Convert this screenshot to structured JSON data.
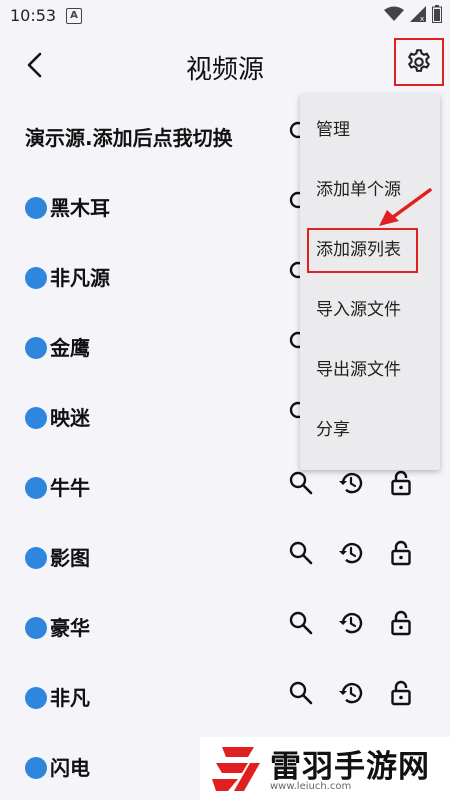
{
  "status": {
    "time": "10:53",
    "notif": "A"
  },
  "header": {
    "title": "视频源"
  },
  "sources": [
    {
      "name": "演示源.添加后点我切换",
      "dot": false
    },
    {
      "name": "黑木耳",
      "dot": true
    },
    {
      "name": "非凡源",
      "dot": true
    },
    {
      "name": "金鹰",
      "dot": true
    },
    {
      "name": "映迷",
      "dot": true
    },
    {
      "name": "牛牛",
      "dot": true
    },
    {
      "name": "影图",
      "dot": true
    },
    {
      "name": "豪华",
      "dot": true
    },
    {
      "name": "非凡",
      "dot": true
    },
    {
      "name": "闪电",
      "dot": true
    }
  ],
  "menu": {
    "items": [
      "管理",
      "添加单个源",
      "添加源列表",
      "导入源文件",
      "导出源文件",
      "分享"
    ],
    "highlighted": "添加源列表"
  },
  "watermark": {
    "brand": "雷羽手游网",
    "url": "www.leiuch.com"
  },
  "colors": {
    "dot": "#2f86de",
    "highlight": "#e02020"
  }
}
